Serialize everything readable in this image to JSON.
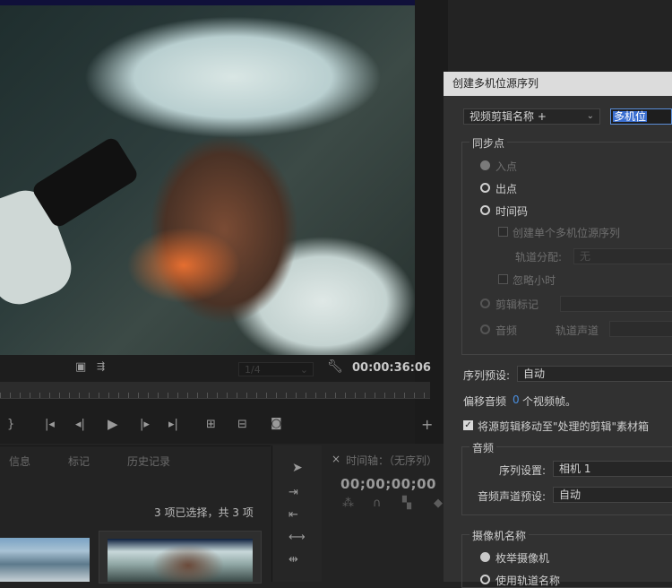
{
  "monitor": {
    "zoom_value": "1/4",
    "timecode": "00:00:36:06"
  },
  "project_panel": {
    "tabs": [
      "信息",
      "标记",
      "历史记录"
    ],
    "selection_count": "3 项已选择，共 3 项"
  },
  "timeline_panel": {
    "close_glyph": "×",
    "title": "时间轴：（无序列）",
    "timecode": "00;00;00;00"
  },
  "dialog": {
    "title": "创建多机位源序列",
    "name_mode": "视频剪辑名称 +",
    "name_value": "多机位",
    "sync_group_label": "同步点",
    "sync_options": [
      "入点",
      "出点",
      "时间码"
    ],
    "create_single_label": "创建单个多机位源序列",
    "track_assign_label": "轨道分配:",
    "track_assign_value": "无",
    "ignore_hours_label": "忽略小时",
    "clip_marker_label": "剪辑标记",
    "audio_sync_label": "音频",
    "track_channel_label": "轨道声道",
    "sequence_preset_label": "序列预设:",
    "sequence_preset_value": "自动",
    "offset_label": "偏移音频",
    "offset_value": "0",
    "offset_suffix": "个视频帧。",
    "move_clips_label": "将源剪辑移动至\"处理的剪辑\"素材箱",
    "audio_group_label": "音频",
    "sequence_settings_label": "序列设置:",
    "sequence_settings_value": "相机 1",
    "audio_channel_preset_label": "音频声道预设:",
    "audio_channel_preset_value": "自动",
    "camera_group_label": "摄像机名称",
    "camera_options": [
      "枚举摄像机",
      "使用轨道名称"
    ]
  },
  "colors": {
    "accent_blue": "#3b6fd0",
    "panel_bg": "#232323",
    "dialog_bg": "#313131"
  }
}
